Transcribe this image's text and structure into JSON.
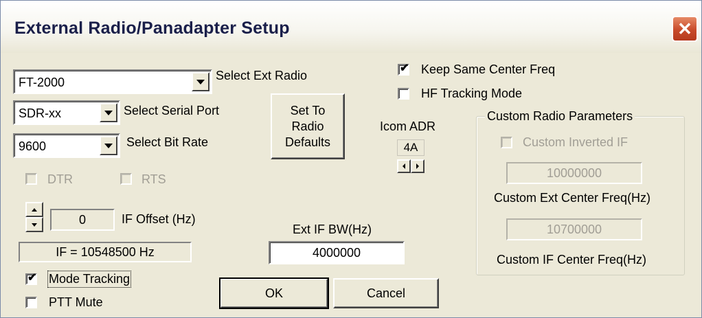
{
  "window": {
    "title": "External Radio/Panadapter Setup"
  },
  "radio": {
    "value": "FT-2000",
    "label": "Select Ext Radio"
  },
  "port": {
    "value": "SDR-xx",
    "label": "Select Serial Port"
  },
  "bitrate": {
    "value": "9600",
    "label": "Select Bit Rate"
  },
  "dtr": {
    "label": "DTR",
    "checked": false,
    "enabled": false
  },
  "rts": {
    "label": "RTS",
    "checked": false,
    "enabled": false
  },
  "defaults_button": {
    "line1": "Set To",
    "line2": "Radio",
    "line3": "Defaults"
  },
  "keep_center": {
    "label": "Keep Same Center Freq",
    "checked": true
  },
  "hf_tracking": {
    "label": "HF Tracking Mode",
    "checked": false
  },
  "icom": {
    "label": "Icom ADR",
    "value": "4A"
  },
  "custom": {
    "group_label": "Custom Radio Parameters",
    "inverted_label": "Custom Inverted IF",
    "ext_center_value": "10000000",
    "ext_center_label": "Custom Ext Center Freq(Hz)",
    "if_center_value": "10700000",
    "if_center_label": "Custom IF Center Freq(Hz)"
  },
  "if_offset": {
    "value": "0",
    "label": "IF Offset (Hz)"
  },
  "if_display": "IF = 10548500 Hz",
  "ext_if_bw": {
    "label": "Ext IF BW(Hz)",
    "value": "4000000"
  },
  "mode_tracking": {
    "label": "Mode Tracking",
    "checked": true
  },
  "ptt_mute": {
    "label": "PTT Mute",
    "checked": false
  },
  "buttons": {
    "ok": "OK",
    "cancel": "Cancel"
  },
  "icons": {
    "close": "close-icon",
    "check": "checkmark-icon"
  },
  "colors": {
    "window_bg": "#ece9d8",
    "close_red": "#c84a2a",
    "disabled_text": "#a19e95"
  }
}
